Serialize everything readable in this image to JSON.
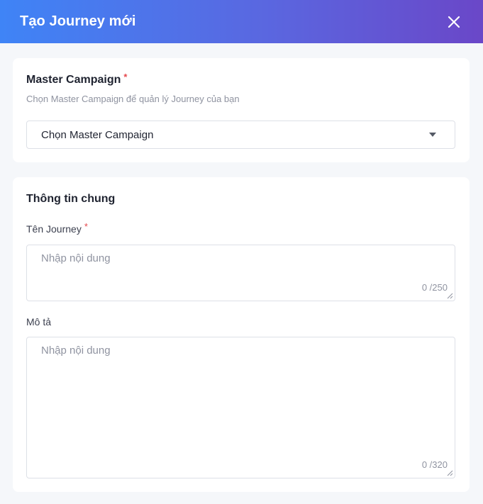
{
  "header": {
    "title": "Tạo Journey mới",
    "close_icon": "close-icon"
  },
  "master_campaign": {
    "label": "Master Campaign",
    "required_mark": "*",
    "hint": "Chọn Master Campaign để quản lý Journey của bạn",
    "select_value": "Chọn Master Campaign",
    "caret_icon": "caret-down-icon"
  },
  "general_info": {
    "title": "Thông tin chung",
    "journey_name": {
      "label": "Tên Journey",
      "required_mark": "*",
      "placeholder": "Nhập nội dung",
      "counter": "0 /250"
    },
    "description": {
      "label": "Mô tả",
      "placeholder": "Nhập nội dung",
      "counter": "0 /320"
    }
  },
  "colors": {
    "header_gradient_start": "#3f84f6",
    "header_gradient_end": "#6a47c8",
    "required": "#e5484d"
  }
}
